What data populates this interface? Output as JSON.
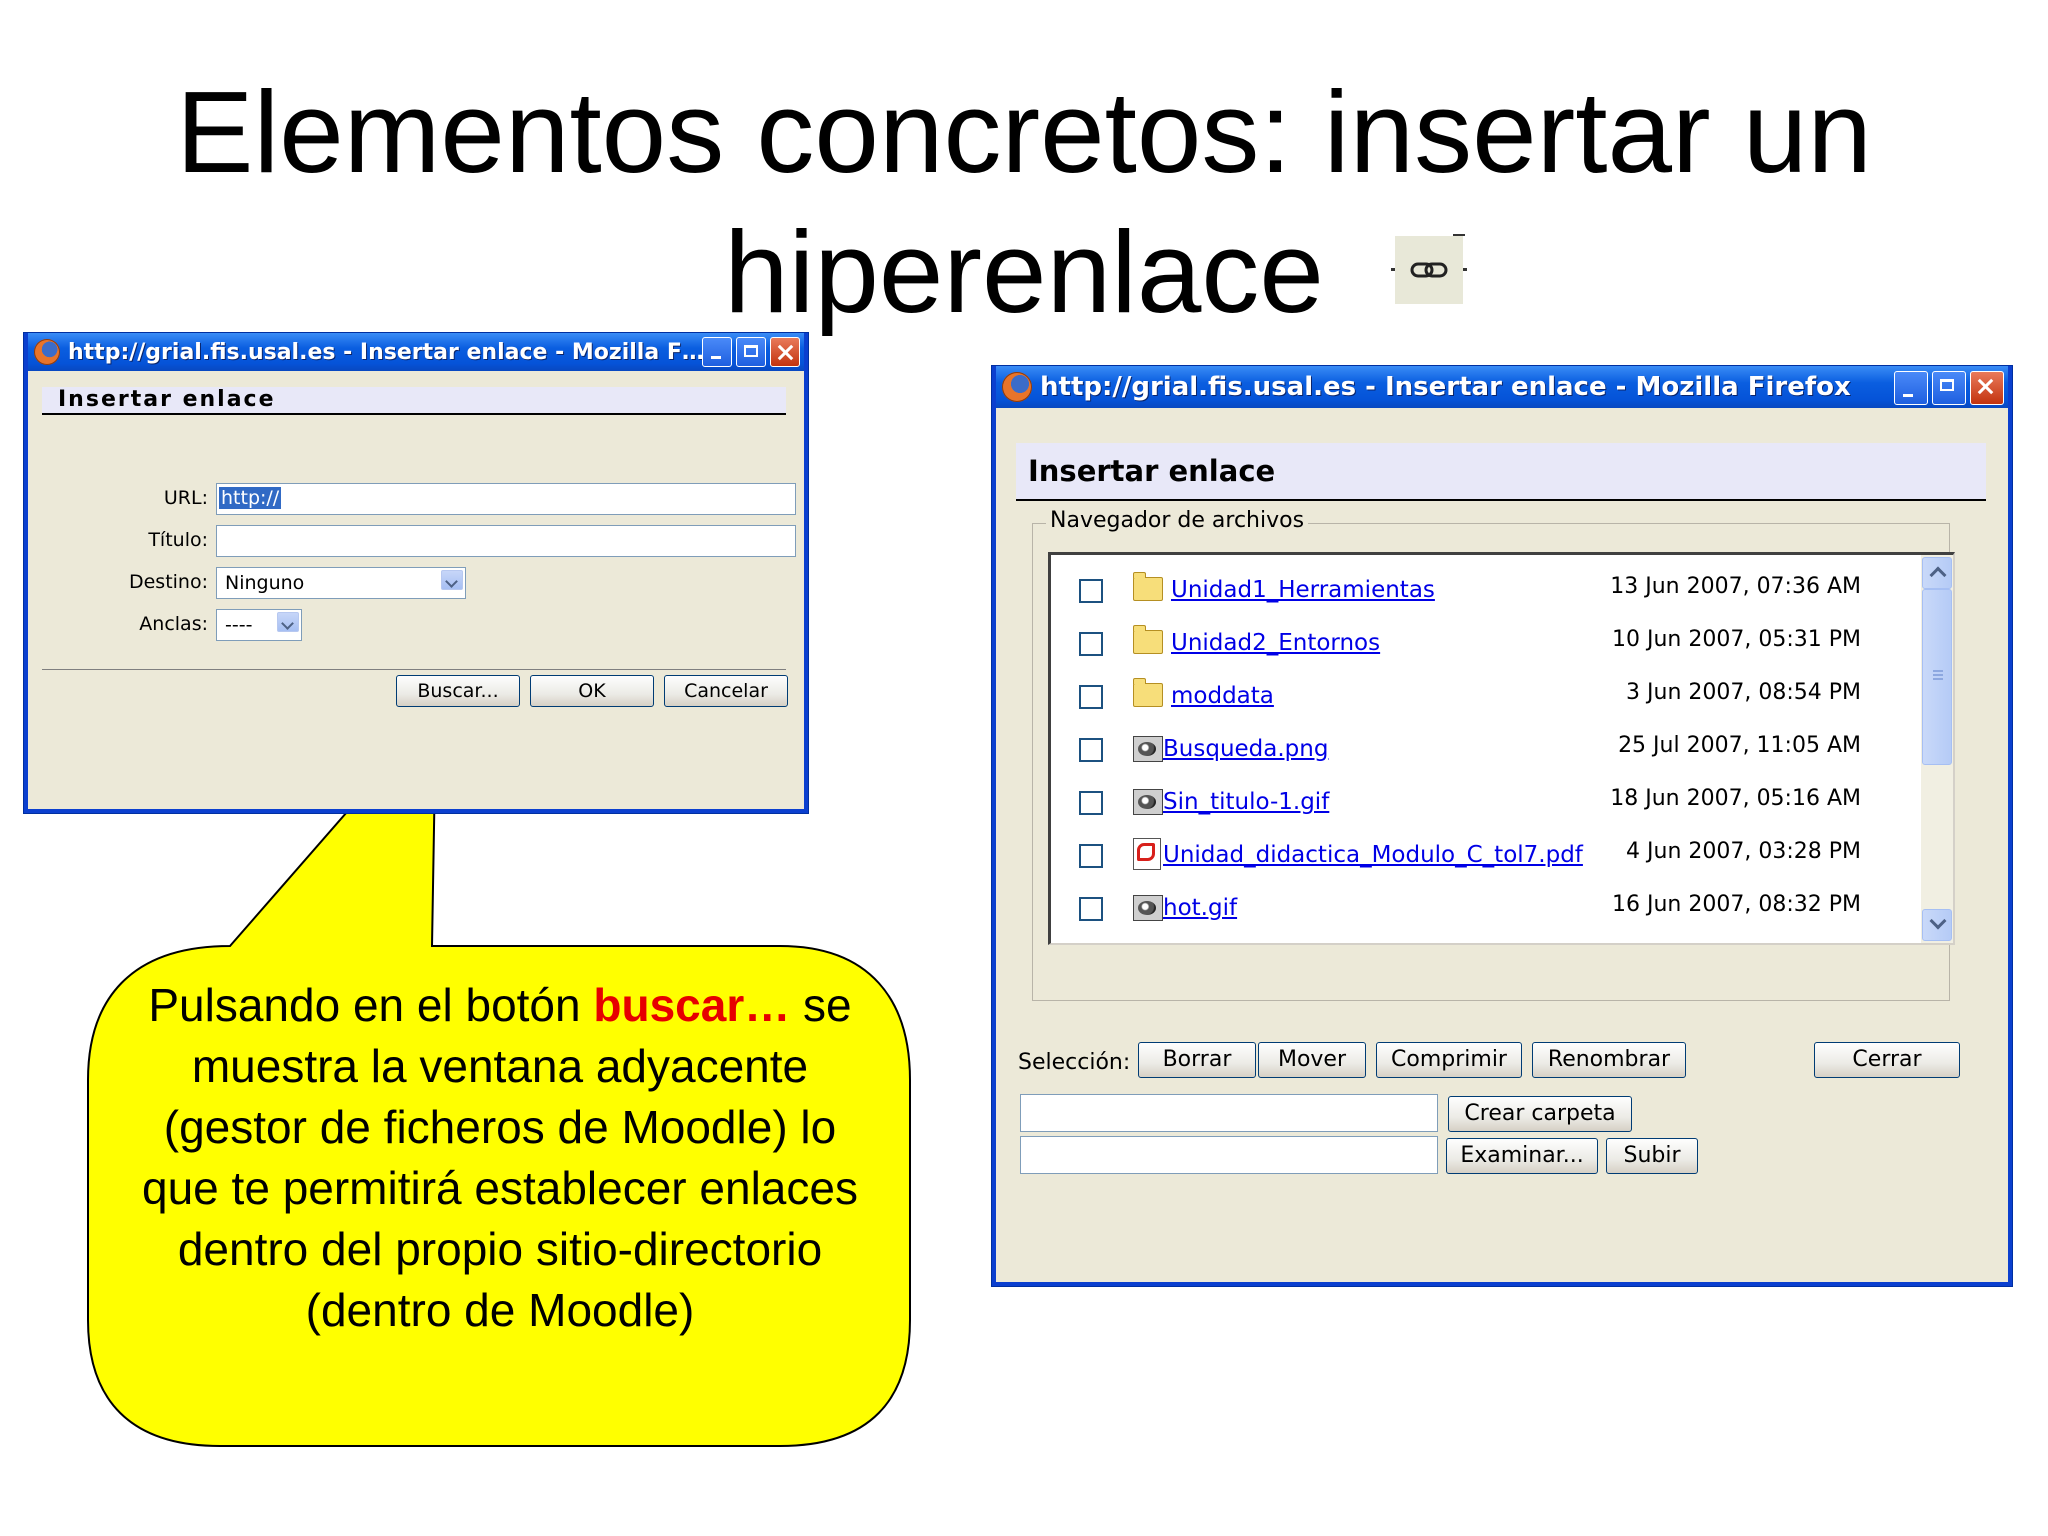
{
  "slide": {
    "title_line1": "Elementos concretos: insertar un",
    "title_line2": "hiperenlace"
  },
  "icons": {
    "link": "link-icon",
    "browser": "firefox-icon",
    "folder": "folder-icon",
    "image": "image-file-icon",
    "pdf": "pdf-file-icon"
  },
  "colors": {
    "xp_titlebar": "#0a5ee0",
    "callout_fill": "#ffff00",
    "highlight": "#e60000",
    "link": "#0000e6"
  },
  "left_dialog": {
    "window_title": "http://grial.fis.usal.es - Insertar enlace - Mozilla F…",
    "header": "Insertar enlace",
    "url_label": "URL:",
    "url_value": "http://",
    "title_label": "Título:",
    "title_value": "",
    "target_label": "Destino:",
    "target_value": "Ninguno",
    "anchors_label": "Anclas:",
    "anchors_value": "----",
    "buttons": {
      "search": "Buscar...",
      "ok": "OK",
      "cancel": "Cancelar"
    }
  },
  "callout": {
    "text_prefix": "Pulsando en el botón ",
    "highlight": "buscar…",
    "text_rest": "se muestra la ventana adyacente (gestor de ficheros de Moodle) lo que te permitirá establecer enlaces dentro del propio sitio-directorio (dentro de Moodle)"
  },
  "right_dialog": {
    "window_title": "http://grial.fis.usal.es - Insertar enlace - Mozilla Firefox",
    "header": "Insertar enlace",
    "group_label": "Navegador de archivos",
    "files": [
      {
        "name": "Unidad1_Herramientas",
        "date": "13 Jun 2007, 07:36 AM",
        "icon": "folder"
      },
      {
        "name": "Unidad2_Entornos",
        "date": "10 Jun 2007, 05:31 PM",
        "icon": "folder"
      },
      {
        "name": "moddata",
        "date": "3 Jun 2007, 08:54 PM",
        "icon": "folder"
      },
      {
        "name": "Busqueda.png",
        "date": "25 Jul 2007, 11:05 AM",
        "icon": "image"
      },
      {
        "name": "Sin_titulo-1.gif",
        "date": "18 Jun 2007, 05:16 AM",
        "icon": "image"
      },
      {
        "name": "Unidad_didactica_Modulo_C_tol7.pdf",
        "date": "4 Jun 2007, 03:28 PM",
        "icon": "pdf"
      },
      {
        "name": "hot.gif",
        "date": "16 Jun 2007, 08:32 PM",
        "icon": "image"
      }
    ],
    "selection_label": "Selección:",
    "buttons": {
      "delete": "Borrar",
      "move": "Mover",
      "compress": "Comprimir",
      "rename": "Renombrar",
      "close": "Cerrar",
      "create_folder": "Crear carpeta",
      "browse": "Examinar...",
      "upload": "Subir"
    },
    "new_folder_value": "",
    "upload_file_value": ""
  }
}
